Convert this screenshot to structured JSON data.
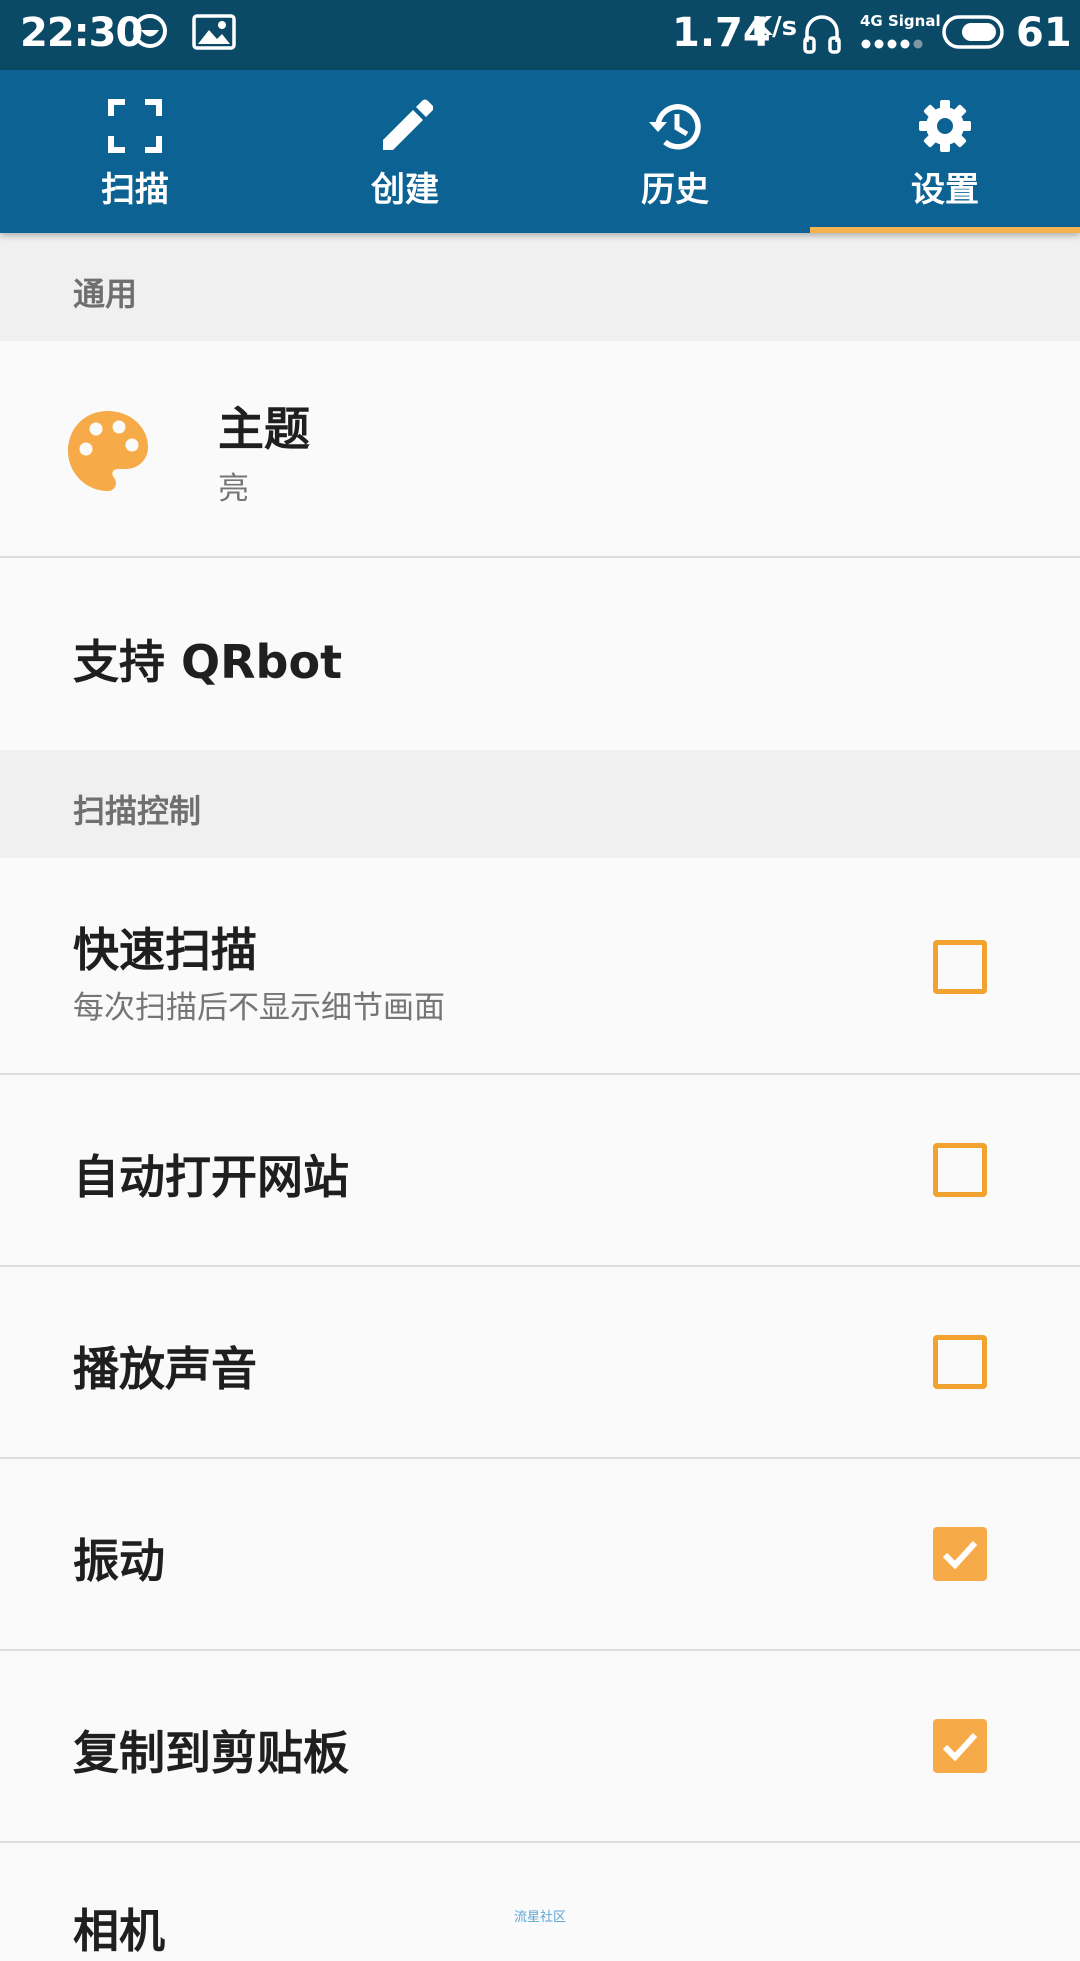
{
  "status_bar": {
    "time": "22:30",
    "speed": "1.74",
    "speed_unit": "K/s",
    "signal_label": "4G Signal",
    "battery": "61"
  },
  "tabs": [
    {
      "label": "扫描",
      "icon": "scan-frame-icon",
      "active": false
    },
    {
      "label": "创建",
      "icon": "pencil-icon",
      "active": false
    },
    {
      "label": "历史",
      "icon": "history-icon",
      "active": false
    },
    {
      "label": "设置",
      "icon": "gear-icon",
      "active": true
    }
  ],
  "sections": {
    "general": "通用",
    "scan_control": "扫描控制"
  },
  "settings": {
    "theme": {
      "title": "主题",
      "value": "亮",
      "icon": "palette-icon"
    },
    "support": {
      "title": "支持 QRbot"
    },
    "quick_scan": {
      "title": "快速扫描",
      "subtitle": "每次扫描后不显示细节画面",
      "checked": false
    },
    "auto_open": {
      "title": "自动打开网站",
      "checked": false
    },
    "play_sound": {
      "title": "播放声音",
      "checked": false
    },
    "vibrate": {
      "title": "振动",
      "checked": true
    },
    "copy_clipboard": {
      "title": "复制到剪贴板",
      "checked": true
    },
    "camera": {
      "title": "相机"
    }
  },
  "watermark": "流星社区",
  "colors": {
    "status_bar": "#0b4a66",
    "tab_bar": "#0c6292",
    "accent": "#f7ab48",
    "section_bg": "#f0f0f0"
  }
}
